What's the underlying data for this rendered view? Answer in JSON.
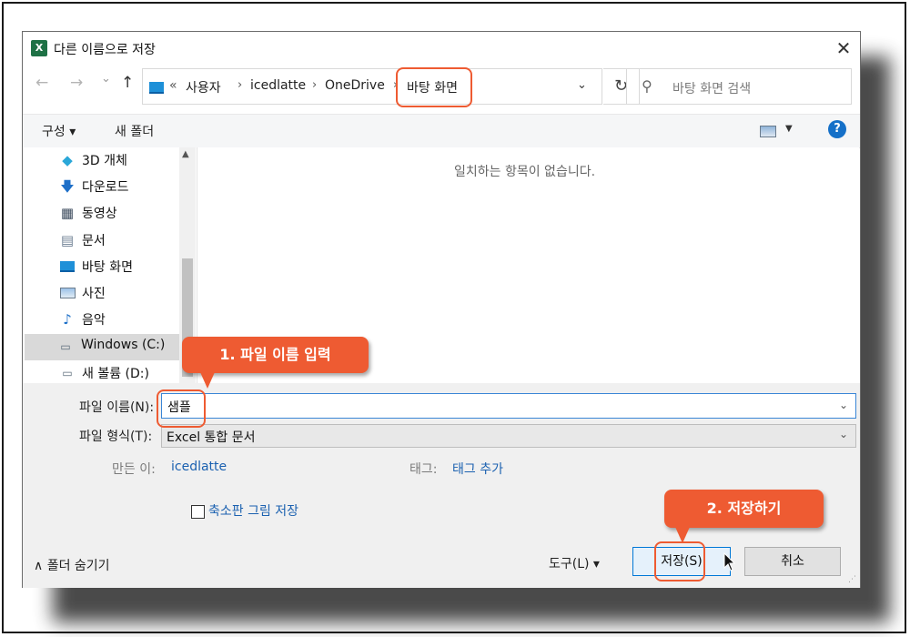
{
  "window": {
    "title": "다른 이름으로 저장",
    "close": "✕"
  },
  "nav": {
    "back": "←",
    "forward": "→",
    "recent": "⌄",
    "up": "↑"
  },
  "address": {
    "overflow": "«",
    "crumbs": [
      "사용자",
      "icedlatte",
      "OneDrive",
      "바탕 화면"
    ],
    "separator": "›",
    "dropdown": "⌄",
    "refresh": "↻"
  },
  "search": {
    "placeholder": "바탕 화면 검색",
    "icon": "search-icon"
  },
  "toolbar": {
    "organize": "구성 ▾",
    "new_folder": "새 폴더",
    "view_caret": "▼",
    "help": "?"
  },
  "sidebar": {
    "items": [
      {
        "label": "3D 개체",
        "icon": "cube-3d-icon"
      },
      {
        "label": "다운로드",
        "icon": "download-arrow-icon"
      },
      {
        "label": "동영상",
        "icon": "film-icon"
      },
      {
        "label": "문서",
        "icon": "document-icon"
      },
      {
        "label": "바탕 화면",
        "icon": "desktop-icon"
      },
      {
        "label": "사진",
        "icon": "picture-icon"
      },
      {
        "label": "음악",
        "icon": "music-note-icon"
      },
      {
        "label": "Windows (C:)",
        "icon": "windows-drive-icon",
        "selected": true
      },
      {
        "label": "새 볼륨 (D:)",
        "icon": "drive-icon"
      }
    ]
  },
  "content": {
    "empty_message": "일치하는 항목이 없습니다."
  },
  "form": {
    "filename_label": "파일 이름(N):",
    "filename_value": "샘플",
    "filetype_label": "파일 형식(T):",
    "filetype_value": "Excel 통합 문서",
    "authors_label": "만든 이:",
    "authors_value": "icedlatte",
    "tags_label": "태그:",
    "tags_value": "태그 추가",
    "thumbnail_label": "축소판 그림 저장",
    "thumbnail_checked": false,
    "chevron": "⌄"
  },
  "footer": {
    "hide_folders": "∧  폴더 숨기기",
    "tools": "도구(L)   ▾",
    "save": "저장(S)",
    "cancel": "취소",
    "grip": "⋰"
  },
  "annotations": {
    "step1": "1. 파일 이름 입력",
    "step2": "2. 저장하기"
  },
  "colors": {
    "accent": "#0078d7",
    "callout": "#ee5b32",
    "link": "#1b61b0",
    "excel": "#1e7145"
  }
}
